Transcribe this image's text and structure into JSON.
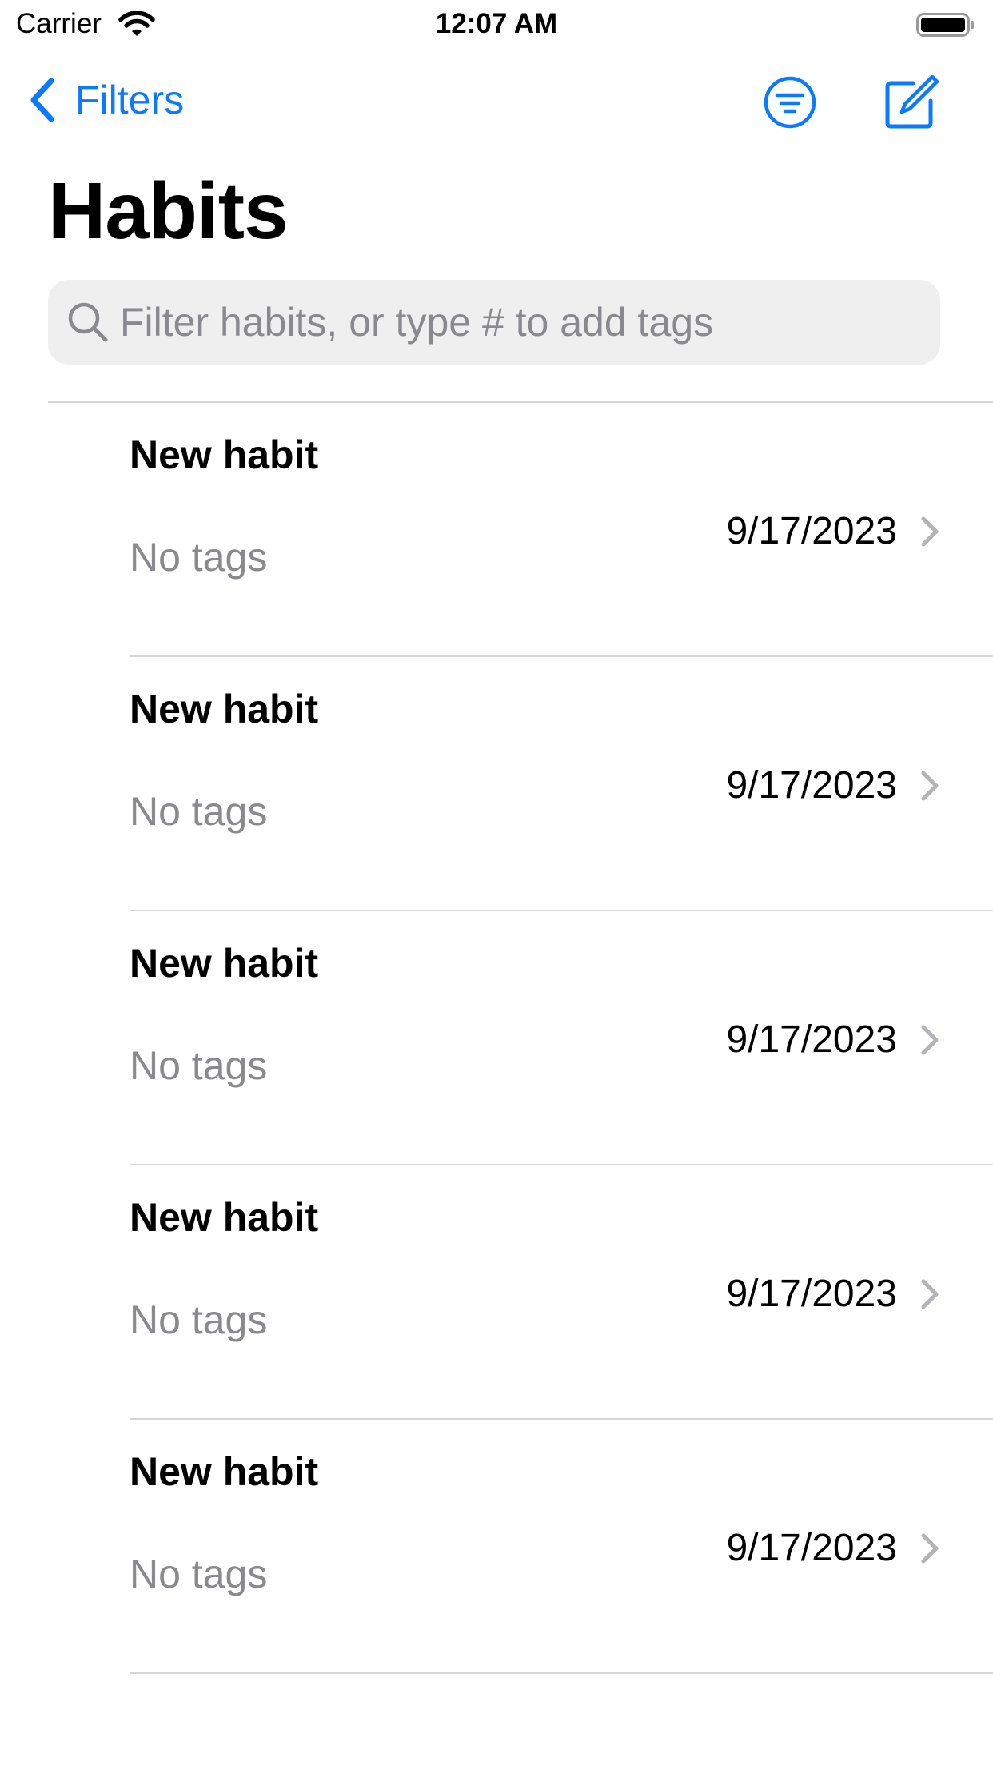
{
  "status_bar": {
    "carrier": "Carrier",
    "time": "12:07 AM"
  },
  "nav": {
    "back_label": "Filters",
    "title": "Habits",
    "accent_color": "#0a7aff"
  },
  "search": {
    "placeholder": "Filter habits, or type # to add tags",
    "value": ""
  },
  "habits": [
    {
      "title": "New habit",
      "subtitle": "No tags",
      "date": "9/17/2023"
    },
    {
      "title": "New habit",
      "subtitle": "No tags",
      "date": "9/17/2023"
    },
    {
      "title": "New habit",
      "subtitle": "No tags",
      "date": "9/17/2023"
    },
    {
      "title": "New habit",
      "subtitle": "No tags",
      "date": "9/17/2023"
    },
    {
      "title": "New habit",
      "subtitle": "No tags",
      "date": "9/17/2023"
    }
  ],
  "icons": {
    "back": "chevron-left-icon",
    "filter": "filter-circle-icon",
    "compose": "compose-icon",
    "search": "search-icon",
    "row_disclosure": "chevron-right-icon"
  }
}
